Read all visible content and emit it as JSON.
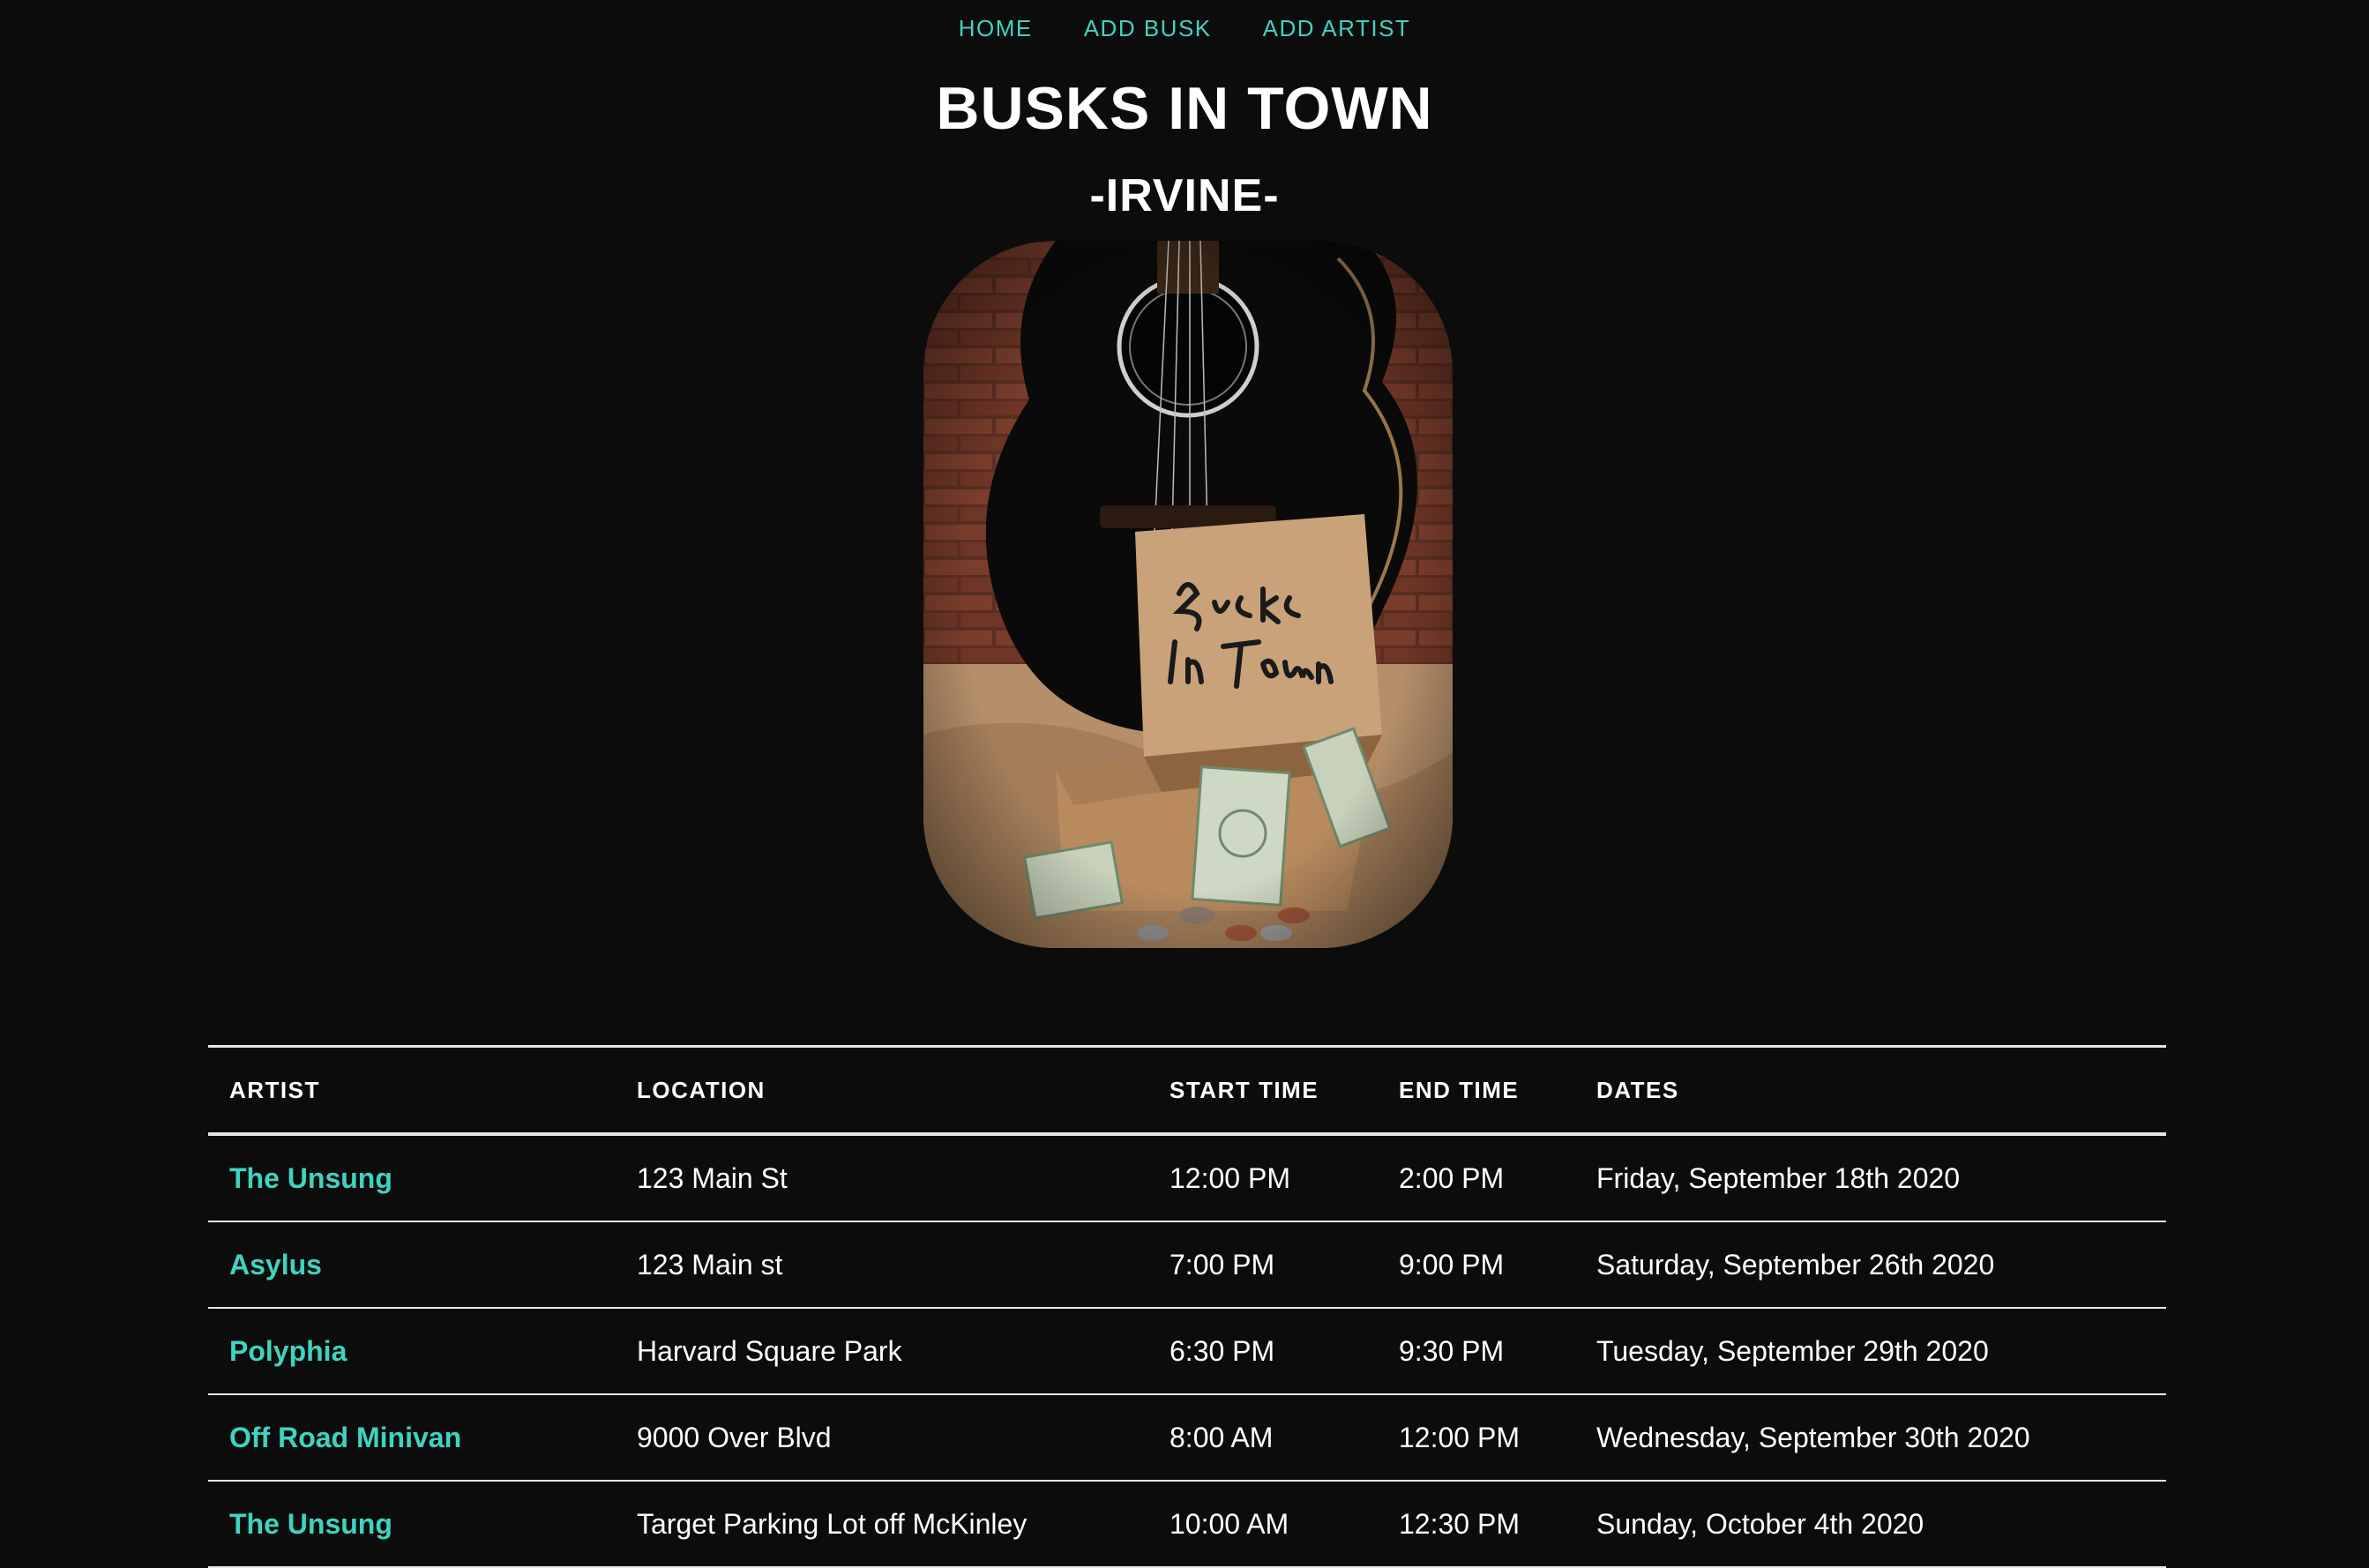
{
  "nav": {
    "home": "HOME",
    "add_busk": "ADD BUSK",
    "add_artist": "ADD ARTIST"
  },
  "header": {
    "title": "BUSKS IN TOWN",
    "city": "-IRVINE-"
  },
  "hero": {
    "box_text_line1": "Busks",
    "box_text_line2": "In Town"
  },
  "table": {
    "headers": {
      "artist": "ARTIST",
      "location": "LOCATION",
      "start_time": "START TIME",
      "end_time": "END TIME",
      "dates": "DATES"
    },
    "rows": [
      {
        "artist": "The Unsung",
        "location": "123 Main St",
        "start": "12:00 PM",
        "end": "2:00 PM",
        "date": "Friday, September 18th 2020"
      },
      {
        "artist": "Asylus",
        "location": "123 Main st",
        "start": "7:00 PM",
        "end": "9:00 PM",
        "date": "Saturday, September 26th 2020"
      },
      {
        "artist": "Polyphia",
        "location": "Harvard Square Park",
        "start": "6:30 PM",
        "end": "9:30 PM",
        "date": "Tuesday, September 29th 2020"
      },
      {
        "artist": "Off Road Minivan",
        "location": "9000 Over Blvd",
        "start": "8:00 AM",
        "end": "12:00 PM",
        "date": "Wednesday, September 30th 2020"
      },
      {
        "artist": "The Unsung",
        "location": "Target Parking Lot off McKinley",
        "start": "10:00 AM",
        "end": "12:30 PM",
        "date": "Sunday, October 4th 2020"
      }
    ]
  },
  "colors": {
    "background": "#0c0c0c",
    "accent": "#3fd3c0",
    "text": "#ffffff"
  }
}
